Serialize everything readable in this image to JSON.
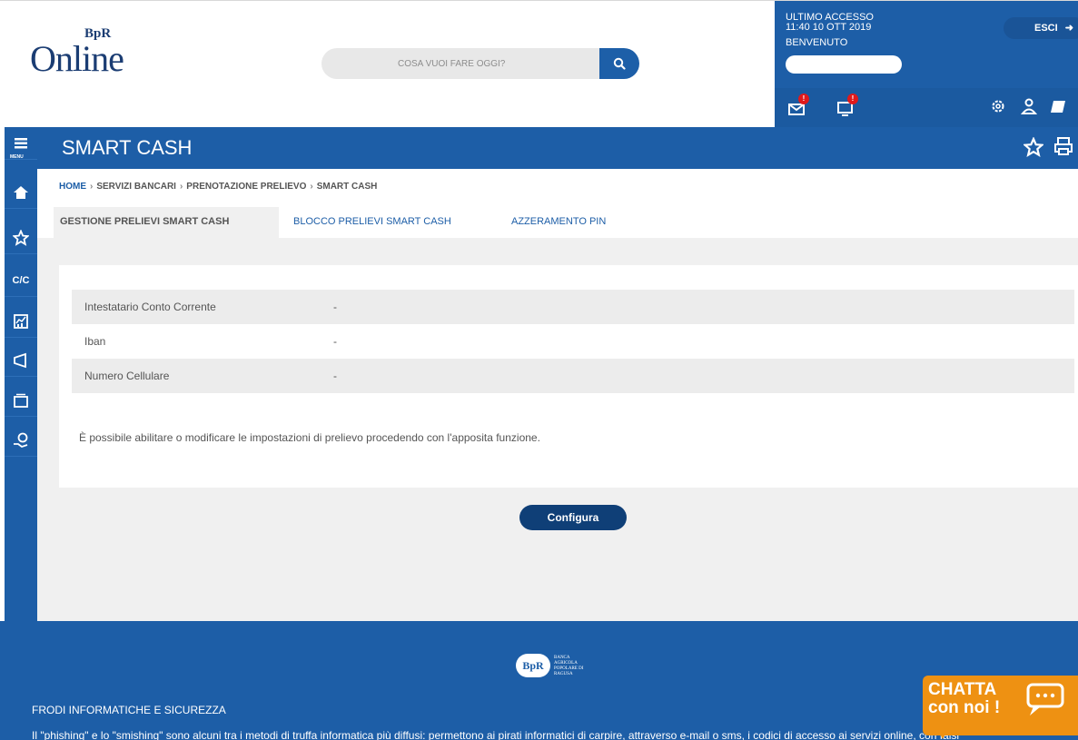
{
  "header": {
    "logo_word": "Online",
    "logo_mark": "BpR",
    "search_placeholder": "COSA VUOI FARE OGGI?",
    "last_access_label": "ULTIMO ACCESSO",
    "last_access_value": "11:40   10 OTT 2019",
    "welcome_label": "BENVENUTO",
    "logout_label": "ESCI",
    "badge_messages": "!",
    "badge_notifications": "!"
  },
  "sidebar": {
    "menu_label": "MENU",
    "cc_label": "C/C"
  },
  "page": {
    "title": "SMART CASH"
  },
  "breadcrumb": {
    "home": "HOME",
    "sep": "›",
    "item1": "SERVIZI BANCARI",
    "item2": "PRENOTAZIONE PRELIEVO",
    "item3": "SMART CASH"
  },
  "tabs": [
    {
      "label": "GESTIONE PRELIEVI SMART CASH"
    },
    {
      "label": "BLOCCO PRELIEVI SMART CASH"
    },
    {
      "label": "AZZERAMENTO PIN"
    }
  ],
  "details": [
    {
      "label": "Intestatario Conto Corrente",
      "value": "-"
    },
    {
      "label": "Iban",
      "value": "-"
    },
    {
      "label": "Numero Cellulare",
      "value": "-"
    }
  ],
  "note": "È possibile abilitare o modificare le impostazioni di prelievo procedendo con l'apposita funzione.",
  "configure_button": "Configura",
  "footer": {
    "bank_mark": "BpR",
    "bank_name": "BANCA AGRICOLA POPOLARE DI RAGUSA",
    "heading": "FRODI INFORMATICHE E SICUREZZA",
    "text": "Il \"phishing\" e lo \"smishing\" sono alcuni tra i metodi di truffa informatica più diffusi: permettono ai pirati informatici di carpire, attraverso e-mail o sms, i codici di accesso ai servizi online, con falsi"
  },
  "chat": {
    "line1": "CHATTA",
    "line2": "con noi !"
  },
  "colors": {
    "primary_blue": "#1d5ea7",
    "dark_blue": "#0f3f77",
    "chat_orange": "#ee9112",
    "alert_red": "#e0191b"
  }
}
